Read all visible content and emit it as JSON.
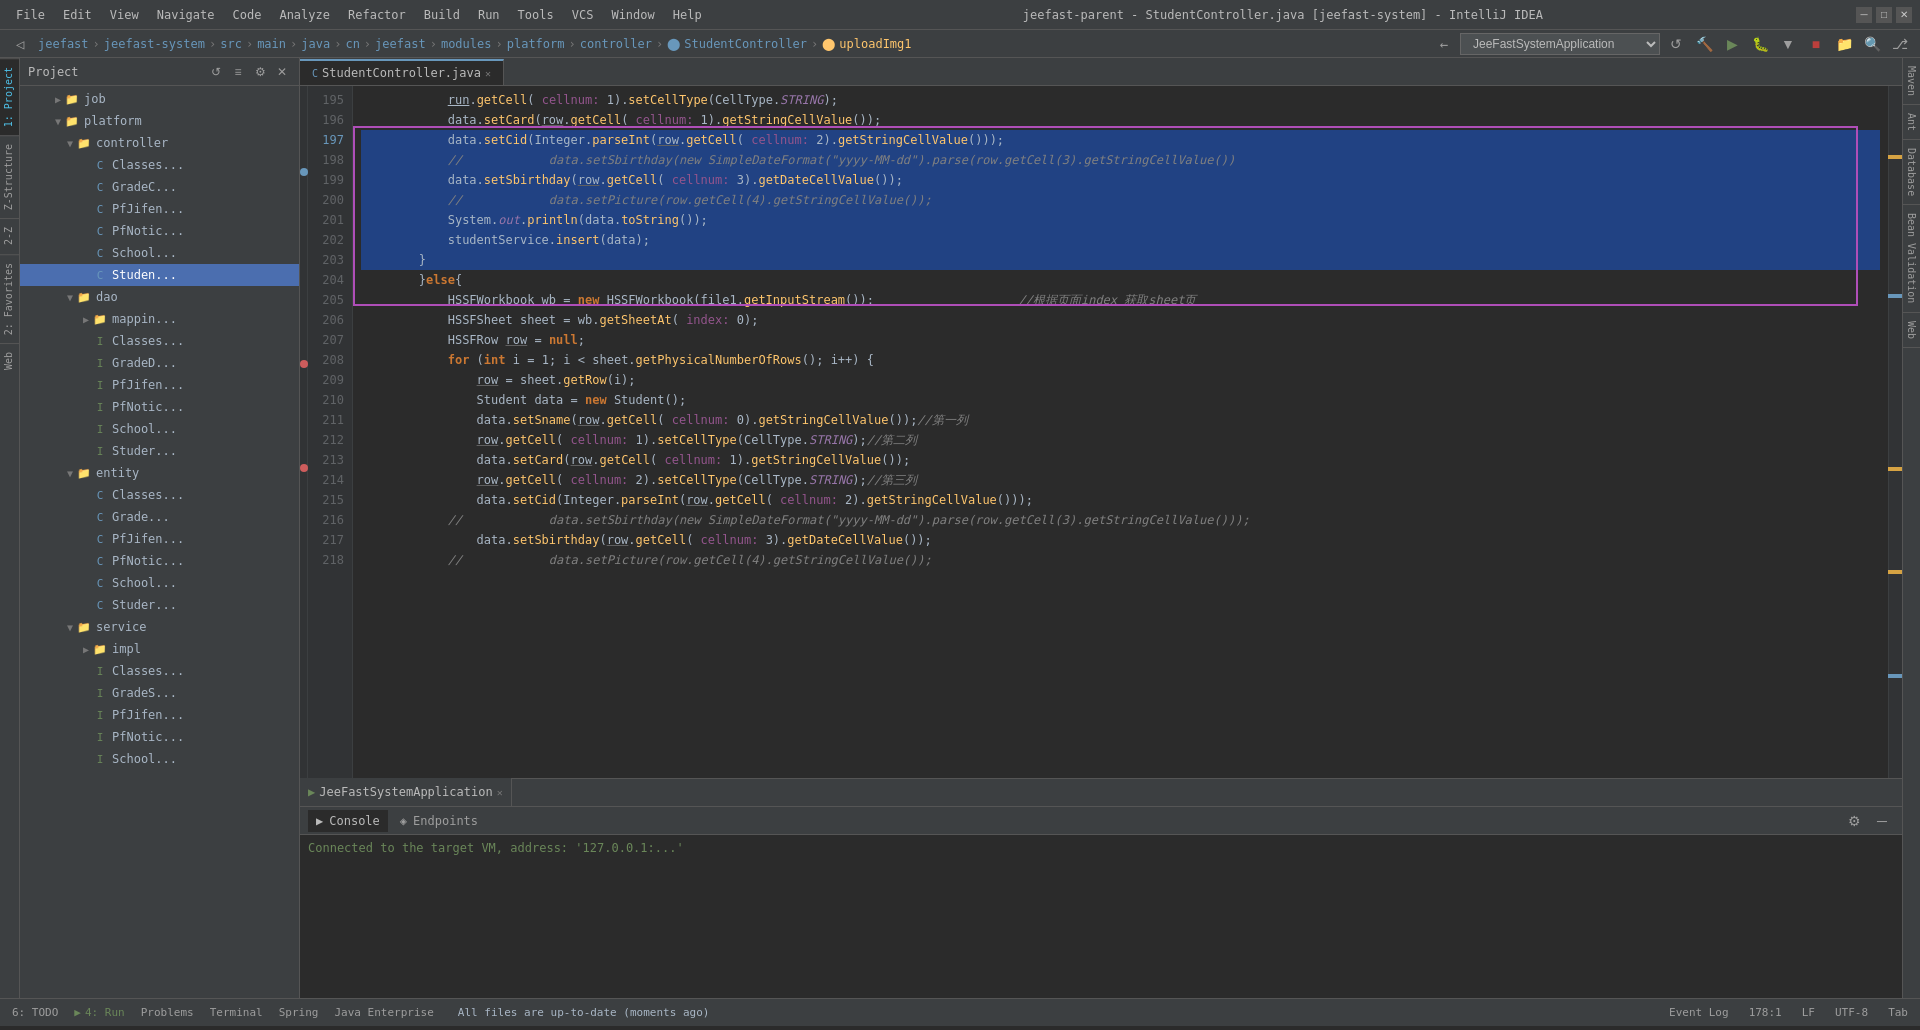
{
  "titleBar": {
    "title": "jeefast-parent - StudentController.java [jeefast-system] - IntelliJ IDEA",
    "menuItems": [
      "File",
      "Edit",
      "View",
      "Navigate",
      "Code",
      "Analyze",
      "Refactor",
      "Build",
      "Run",
      "Tools",
      "VCS",
      "Window",
      "Help"
    ]
  },
  "breadcrumb": {
    "items": [
      "jeefast",
      "jeefast-system",
      "src",
      "main",
      "java",
      "cn",
      "jeefast",
      "modules",
      "platform",
      "controller",
      "StudentController",
      "uploadImg1"
    ]
  },
  "projectPanel": {
    "title": "Project",
    "tree": [
      {
        "indent": 2,
        "type": "folder",
        "name": "job",
        "expanded": false
      },
      {
        "indent": 2,
        "type": "folder",
        "name": "platform",
        "expanded": true
      },
      {
        "indent": 3,
        "type": "folder",
        "name": "controller",
        "expanded": true
      },
      {
        "indent": 4,
        "type": "class",
        "name": "Classes...",
        "color": "blue"
      },
      {
        "indent": 4,
        "type": "class",
        "name": "GradeC...",
        "color": "blue"
      },
      {
        "indent": 4,
        "type": "class",
        "name": "PfJifen...",
        "color": "blue"
      },
      {
        "indent": 4,
        "type": "class",
        "name": "PfNotic...",
        "color": "blue"
      },
      {
        "indent": 4,
        "type": "class",
        "name": "School...",
        "color": "blue"
      },
      {
        "indent": 4,
        "type": "class",
        "name": "Studen...",
        "color": "blue",
        "selected": true
      },
      {
        "indent": 3,
        "type": "folder",
        "name": "dao",
        "expanded": true
      },
      {
        "indent": 4,
        "type": "folder",
        "name": "mappin...",
        "expanded": false
      },
      {
        "indent": 4,
        "type": "interface",
        "name": "Classes...",
        "color": "green"
      },
      {
        "indent": 4,
        "type": "interface",
        "name": "GradeD...",
        "color": "green"
      },
      {
        "indent": 4,
        "type": "interface",
        "name": "PfJifen...",
        "color": "green"
      },
      {
        "indent": 4,
        "type": "interface",
        "name": "PfNotic...",
        "color": "green"
      },
      {
        "indent": 4,
        "type": "interface",
        "name": "School...",
        "color": "green"
      },
      {
        "indent": 4,
        "type": "interface",
        "name": "Studer...",
        "color": "green"
      },
      {
        "indent": 3,
        "type": "folder",
        "name": "entity",
        "expanded": true
      },
      {
        "indent": 4,
        "type": "class",
        "name": "Classes...",
        "color": "blue"
      },
      {
        "indent": 4,
        "type": "class",
        "name": "Grade...",
        "color": "blue"
      },
      {
        "indent": 4,
        "type": "class",
        "name": "PfJifen...",
        "color": "blue"
      },
      {
        "indent": 4,
        "type": "class",
        "name": "PfNotic...",
        "color": "blue"
      },
      {
        "indent": 4,
        "type": "class",
        "name": "School...",
        "color": "blue"
      },
      {
        "indent": 4,
        "type": "class",
        "name": "Studer...",
        "color": "blue"
      },
      {
        "indent": 3,
        "type": "folder",
        "name": "service",
        "expanded": true
      },
      {
        "indent": 4,
        "type": "folder",
        "name": "impl",
        "expanded": false
      },
      {
        "indent": 4,
        "type": "interface",
        "name": "Classes...",
        "color": "green"
      },
      {
        "indent": 4,
        "type": "interface",
        "name": "GradeS...",
        "color": "green"
      },
      {
        "indent": 4,
        "type": "interface",
        "name": "PfJifen...",
        "color": "green"
      },
      {
        "indent": 4,
        "type": "interface",
        "name": "PfNotic...",
        "color": "green"
      },
      {
        "indent": 4,
        "type": "interface",
        "name": "School...",
        "color": "green"
      }
    ]
  },
  "editor": {
    "filename": "StudentController.java",
    "lines": [
      {
        "num": 195,
        "content": "            run.getCell( cellnum: 1).setCellType(CellType.STRING);"
      },
      {
        "num": 196,
        "content": "            data.setCard(row.getCell( cellnum: 1).getStringCellValue());"
      },
      {
        "num": 197,
        "content": "            data.setCid(Integer.parseInt(row.getCell( cellnum: 2).getStringCellValue()));",
        "selected": true
      },
      {
        "num": 198,
        "content": "            //            data.setSbirthday(new SimpleDateFormat(\"yyyy-MM-dd\").parse(row.getCell(3).getStringCellValue())",
        "selected": true,
        "comment": true
      },
      {
        "num": 199,
        "content": "            data.setSbirthday(row.getCell( cellnum: 3).getDateCellValue());",
        "selected": true
      },
      {
        "num": 200,
        "content": "            //            data.setPicture(row.getCell(4).getStringCellValue());",
        "selected": true,
        "comment": true
      },
      {
        "num": 201,
        "content": "            System.out.println(data.toString());",
        "selected": true
      },
      {
        "num": 202,
        "content": "            studentService.insert(data);",
        "selected": true
      },
      {
        "num": 203,
        "content": "        }",
        "selected": true
      },
      {
        "num": 204,
        "content": "        }else{"
      },
      {
        "num": 205,
        "content": "            HSSFWorkbook wb = new HSSFWorkbook(file1.getInputStream());                    //根据页面index 获取sheet页"
      },
      {
        "num": 206,
        "content": "            HSSFSheet sheet = wb.getSheetAt( index: 0);"
      },
      {
        "num": 207,
        "content": "            HSSFRow row = null;"
      },
      {
        "num": 208,
        "content": "            for (int i = 1; i < sheet.getPhysicalNumberOfRows(); i++) {"
      },
      {
        "num": 209,
        "content": "                row = sheet.getRow(i);"
      },
      {
        "num": 210,
        "content": "                Student data = new Student();"
      },
      {
        "num": 211,
        "content": "                data.setSname(row.getCell( cellnum: 0).getStringCellValue());//第一列"
      },
      {
        "num": 212,
        "content": "                row.getCell( cellnum: 1).setCellType(CellType.STRING);//第二列"
      },
      {
        "num": 213,
        "content": "                data.setCard(row.getCell( cellnum: 1).getStringCellValue());"
      },
      {
        "num": 214,
        "content": "                row.getCell( cellnum: 2).setCellType(CellType.STRING);//第三列"
      },
      {
        "num": 215,
        "content": "                data.setCid(Integer.parseInt(row.getCell( cellnum: 2).getStringCellValue()));"
      },
      {
        "num": 216,
        "content": "            //            data.setSbirthday(new SimpleDateFormat(\"yyyy-MM-dd\").parse(row.getCell(3).getStringCellValue()));",
        "comment": true
      },
      {
        "num": 217,
        "content": "                data.setSbirthday(row.getCell( cellnum: 3).getDateCellValue());"
      },
      {
        "num": 218,
        "content": "            //            data.setPicture(row.getCell(4).getStringCellValue());",
        "comment": true
      }
    ]
  },
  "bottomPanel": {
    "tabs": [
      {
        "label": "Console",
        "icon": "▶"
      },
      {
        "label": "Endpoints",
        "icon": "◈"
      }
    ],
    "runLabel": "JeeFastSystemApplication",
    "activeTab": "Console"
  },
  "statusBar": {
    "message": "All files are up-to-date (moments ago)",
    "position": "178:1",
    "encoding": "UTF-8",
    "lineEnding": "LF",
    "indent": "Tab",
    "runItems": [
      "6: TODO",
      "4: Run",
      "Problems",
      "Terminal",
      "Spring",
      "Java Enterprise"
    ],
    "rightItems": [
      "Event Log"
    ]
  },
  "appSelector": "JeeFastSystemApplication",
  "rightPanels": [
    "Maven",
    "Ant",
    "Database",
    "Bean Validation",
    "Web"
  ]
}
